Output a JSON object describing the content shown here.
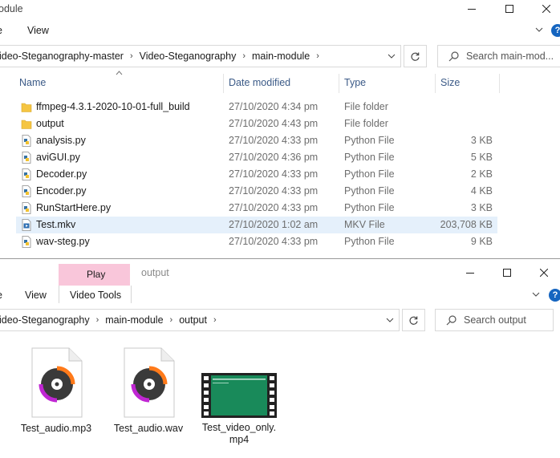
{
  "window1": {
    "title": "odule",
    "ribbon": {
      "view_tab": "View"
    },
    "breadcrumb": [
      "ideo-Steganography-master",
      "Video-Steganography",
      "main-module"
    ],
    "search_placeholder": "Search main-mod...",
    "columns": {
      "name": "Name",
      "date": "Date modified",
      "type": "Type",
      "size": "Size"
    },
    "files": [
      {
        "name": "ffmpeg-4.3.1-2020-10-01-full_build",
        "date": "27/10/2020 4:34 pm",
        "type": "File folder",
        "size": "",
        "icon": "folder-icon"
      },
      {
        "name": "output",
        "date": "27/10/2020 4:43 pm",
        "type": "File folder",
        "size": "",
        "icon": "folder-icon"
      },
      {
        "name": "analysis.py",
        "date": "27/10/2020 4:33 pm",
        "type": "Python File",
        "size": "3 KB",
        "icon": "python-file-icon"
      },
      {
        "name": "aviGUI.py",
        "date": "27/10/2020 4:36 pm",
        "type": "Python File",
        "size": "5 KB",
        "icon": "python-file-icon"
      },
      {
        "name": "Decoder.py",
        "date": "27/10/2020 4:33 pm",
        "type": "Python File",
        "size": "2 KB",
        "icon": "python-file-icon"
      },
      {
        "name": "Encoder.py",
        "date": "27/10/2020 4:33 pm",
        "type": "Python File",
        "size": "4 KB",
        "icon": "python-file-icon"
      },
      {
        "name": "RunStartHere.py",
        "date": "27/10/2020 4:33 pm",
        "type": "Python File",
        "size": "3 KB",
        "icon": "python-file-icon"
      },
      {
        "name": "Test.mkv",
        "date": "27/10/2020 1:02 am",
        "type": "MKV File",
        "size": "203,708 KB",
        "icon": "mkv-file-icon",
        "selected": true
      },
      {
        "name": "wav-steg.py",
        "date": "27/10/2020 4:33 pm",
        "type": "Python File",
        "size": "9 KB",
        "icon": "python-file-icon"
      }
    ]
  },
  "window2": {
    "title": "output",
    "ribbon": {
      "play_tab": "Play",
      "view_tab": "View",
      "video_tools_tab": "Video Tools",
      "accent": "#f9c6da"
    },
    "breadcrumb": [
      "ideo-Steganography",
      "main-module",
      "output"
    ],
    "search_placeholder": "Search output",
    "items": [
      {
        "name": "Test_audio.mp3",
        "icon": "audio-file-icon"
      },
      {
        "name": "Test_audio.wav",
        "icon": "audio-file-icon"
      },
      {
        "name": "Test_video_only.mp4",
        "line1": "Test_video_only.",
        "line2": "mp4",
        "icon": "video-thumbnail"
      }
    ]
  },
  "colors": {
    "folder": "#f5c542",
    "selection": "#e5f0fb",
    "header_text": "#3b5a87",
    "help": "#1565c0",
    "video_green": "#198a5a"
  }
}
